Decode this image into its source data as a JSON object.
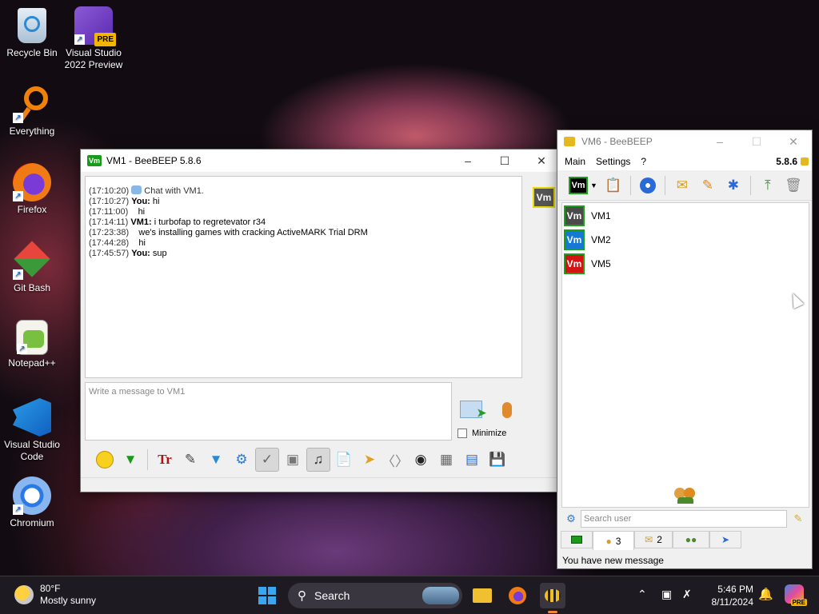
{
  "desktop": {
    "icons": [
      {
        "label": "Recycle Bin",
        "icon": "recycle-bin-icon"
      },
      {
        "label": "Visual Studio 2022 Preview",
        "icon": "visual-studio-icon",
        "badge": "PRE"
      },
      {
        "label": "Everything",
        "icon": "magnifier-icon"
      },
      {
        "label": "Firefox",
        "icon": "firefox-icon"
      },
      {
        "label": "Git Bash",
        "icon": "git-bash-icon"
      },
      {
        "label": "Notepad++",
        "icon": "notepad-plus-plus-icon"
      },
      {
        "label": "Visual Studio Code",
        "icon": "vscode-icon"
      },
      {
        "label": "Chromium",
        "icon": "chromium-icon"
      }
    ]
  },
  "chat_window": {
    "title": "VM1 - BeeBEEP 5.8.6",
    "badge": "Vm",
    "side_badge": "Vm",
    "messages": [
      {
        "time": "(17:10:20)",
        "sender": "",
        "text": "Chat with VM1."
      },
      {
        "time": "(17:10:27)",
        "sender": "You:",
        "text": "hi"
      },
      {
        "time": "(17:11:00)",
        "sender": "",
        "text": "hi"
      },
      {
        "time": "(17:14:11)",
        "sender": "VM1:",
        "text": "i turbofap to regretevator r34"
      },
      {
        "time": "(17:23:38)",
        "sender": "",
        "text": "we's installing games with cracking ActiveMARK Trial DRM"
      },
      {
        "time": "(17:44:28)",
        "sender": "",
        "text": "hi"
      },
      {
        "time": "(17:45:57)",
        "sender": "You:",
        "text": "sup"
      }
    ],
    "input_placeholder": "Write a message to VM1",
    "minimize_label": "Minimize"
  },
  "main_window": {
    "title": "VM6 - BeeBEEP",
    "menu": [
      "Main",
      "Settings",
      "?"
    ],
    "version": "5.8.6",
    "status_badge": "Vm",
    "users": [
      {
        "badge": "Vm",
        "name": "VM1",
        "color": "#4a4a4a"
      },
      {
        "badge": "Vm",
        "name": "VM2",
        "color": "#1478d4"
      },
      {
        "badge": "Vm",
        "name": "VM5",
        "color": "#d41414"
      }
    ],
    "search_placeholder": "Search user",
    "tabs": [
      {
        "count": "",
        "icon": "monitor-icon"
      },
      {
        "count": "3",
        "icon": "users-icon"
      },
      {
        "count": "2",
        "icon": "chat-icon"
      },
      {
        "count": "",
        "icon": "group-icon"
      },
      {
        "count": "",
        "icon": "share-icon"
      }
    ],
    "status_text": "You have new message"
  },
  "taskbar": {
    "weather_temp": "80°F",
    "weather_desc": "Mostly sunny",
    "search_label": "Search",
    "time": "5:46 PM",
    "date": "8/11/2024",
    "copilot_badge": "PRE"
  }
}
